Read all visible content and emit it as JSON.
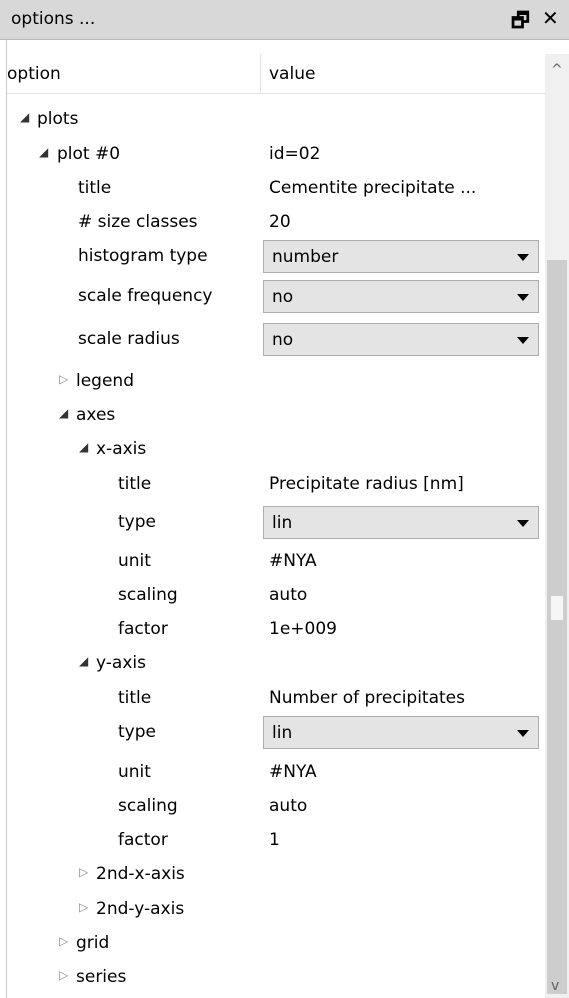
{
  "window": {
    "title": "options ...",
    "restore_glyph": "🗗",
    "close_glyph": "✕"
  },
  "columns": {
    "option": "option",
    "value": "value"
  },
  "tree": {
    "plots": "plots",
    "plot0": {
      "label": "plot #0",
      "value": "id=02"
    },
    "title": {
      "label": "title",
      "value": "Cementite precipitate ..."
    },
    "size_classes": {
      "label": "# size classes",
      "value": "20"
    },
    "histogram_type": {
      "label": "histogram type",
      "value": "number"
    },
    "scale_frequency": {
      "label": "scale frequency",
      "value": "no"
    },
    "scale_radius": {
      "label": "scale radius",
      "value": "no"
    },
    "legend": "legend",
    "axes": "axes",
    "x_axis": {
      "label": "x-axis",
      "title": {
        "label": "title",
        "value": "Precipitate radius [nm]"
      },
      "type": {
        "label": "type",
        "value": "lin"
      },
      "unit": {
        "label": "unit",
        "value": "#NYA"
      },
      "scaling": {
        "label": "scaling",
        "value": "auto"
      },
      "factor": {
        "label": "factor",
        "value": "1e+009"
      }
    },
    "y_axis": {
      "label": "y-axis",
      "title": {
        "label": "title",
        "value": "Number of precipitates"
      },
      "type": {
        "label": "type",
        "value": "lin"
      },
      "unit": {
        "label": "unit",
        "value": "#NYA"
      },
      "scaling": {
        "label": "scaling",
        "value": "auto"
      },
      "factor": {
        "label": "factor",
        "value": "1"
      }
    },
    "x2_axis": "2nd-x-axis",
    "y2_axis": "2nd-y-axis",
    "grid": "grid",
    "series": "series"
  },
  "glyphs": {
    "expanded": "◢",
    "collapsed": "▷",
    "scroll_up": "^",
    "scroll_down": "v"
  }
}
